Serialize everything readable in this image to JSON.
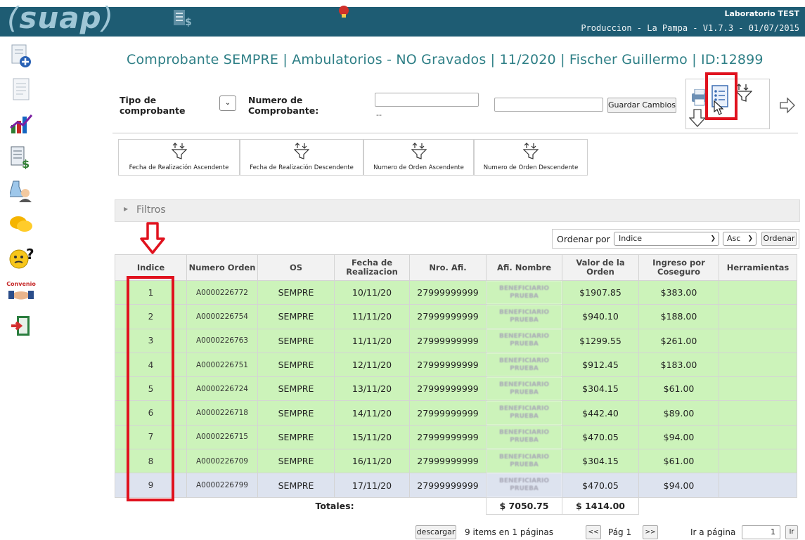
{
  "header": {
    "logo": "suap",
    "lab": "Laboratorio TEST",
    "prod": "Produccion - La Pampa - V1.7.3 - 01/07/2015"
  },
  "sidebar": {
    "items": [
      {
        "icon": "new-document-icon"
      },
      {
        "icon": "document-icon"
      },
      {
        "icon": "chart-icon"
      },
      {
        "icon": "billing-document-icon"
      },
      {
        "icon": "lab-user-icon"
      },
      {
        "icon": "chat-icon"
      },
      {
        "icon": "help-icon"
      },
      {
        "icon": "convenio-icon",
        "label": "Convenio"
      },
      {
        "icon": "exit-icon"
      }
    ]
  },
  "page": {
    "title": "Comprobante SEMPRE | Ambulatorios - NO Gravados | 11/2020 | Fischer Guillermo | ID:12899"
  },
  "form": {
    "tipo_label": "Tipo de comprobante",
    "numero_label": "Numero de Comprobante:",
    "dashes": "--",
    "guardar_label": "Guardar Cambios"
  },
  "sort_buttons": [
    "Fecha de Realización Ascendente",
    "Fecha de Realización Descendente",
    "Numero de Orden Ascendente",
    "Numero de Orden Descendente"
  ],
  "filters": {
    "label": "Filtros"
  },
  "order": {
    "label": "Ordenar por",
    "selected": "Indice",
    "direction": "Asc",
    "button": "Ordenar"
  },
  "table": {
    "headers": [
      "Indice",
      "Numero Orden",
      "OS",
      "Fecha de Realizacion",
      "Nro. Afi.",
      "Afi. Nombre",
      "Valor de la Orden",
      "Ingreso por Coseguro",
      "Herramientas"
    ],
    "rows": [
      {
        "indice": "1",
        "orden": "A0000226772",
        "os": "SEMPRE",
        "fecha": "10/11/20",
        "afi": "27999999999",
        "nombre": "BENEFICIARIO PRUEBA",
        "valor": "$1907.85",
        "coseguro": "$383.00",
        "herr": ""
      },
      {
        "indice": "2",
        "orden": "A0000226754",
        "os": "SEMPRE",
        "fecha": "11/11/20",
        "afi": "27999999999",
        "nombre": "BENEFICIARIO PRUEBA",
        "valor": "$940.10",
        "coseguro": "$188.00",
        "herr": ""
      },
      {
        "indice": "3",
        "orden": "A0000226763",
        "os": "SEMPRE",
        "fecha": "11/11/20",
        "afi": "27999999999",
        "nombre": "BENEFICIARIO PRUEBA",
        "valor": "$1299.55",
        "coseguro": "$261.00",
        "herr": ""
      },
      {
        "indice": "4",
        "orden": "A0000226751",
        "os": "SEMPRE",
        "fecha": "12/11/20",
        "afi": "27999999999",
        "nombre": "BENEFICIARIO PRUEBA",
        "valor": "$912.45",
        "coseguro": "$183.00",
        "herr": ""
      },
      {
        "indice": "5",
        "orden": "A0000226724",
        "os": "SEMPRE",
        "fecha": "13/11/20",
        "afi": "27999999999",
        "nombre": "BENEFICIARIO PRUEBA",
        "valor": "$304.15",
        "coseguro": "$61.00",
        "herr": ""
      },
      {
        "indice": "6",
        "orden": "A0000226718",
        "os": "SEMPRE",
        "fecha": "14/11/20",
        "afi": "27999999999",
        "nombre": "BENEFICIARIO PRUEBA",
        "valor": "$442.40",
        "coseguro": "$89.00",
        "herr": ""
      },
      {
        "indice": "7",
        "orden": "A0000226715",
        "os": "SEMPRE",
        "fecha": "15/11/20",
        "afi": "27999999999",
        "nombre": "BENEFICIARIO PRUEBA",
        "valor": "$470.05",
        "coseguro": "$94.00",
        "herr": ""
      },
      {
        "indice": "8",
        "orden": "A0000226709",
        "os": "SEMPRE",
        "fecha": "16/11/20",
        "afi": "27999999999",
        "nombre": "BENEFICIARIO PRUEBA",
        "valor": "$304.15",
        "coseguro": "$61.00",
        "herr": ""
      },
      {
        "indice": "9",
        "orden": "A0000226799",
        "os": "SEMPRE",
        "fecha": "17/11/20",
        "afi": "27999999999",
        "nombre": "BENEFICIARIO PRUEBA",
        "valor": "$470.05",
        "coseguro": "$94.00",
        "herr": ""
      }
    ],
    "totals_label": "Totales:",
    "total_valor": "$ 7050.75",
    "total_coseguro": "$ 1414.00"
  },
  "footer": {
    "descargar": "descargar",
    "items_info": "9 items en 1 páginas",
    "prev": "<<",
    "page": "Pág 1",
    "next": ">>",
    "ir_label": "Ir a página",
    "ir_value": "1",
    "ir_btn": "Ir"
  },
  "colors": {
    "header_bg": "#1e5c73",
    "row_green": "#ccf3ba",
    "row_selected": "#dde3ef",
    "title_teal": "#2e7f86",
    "highlight_red": "#e0121e"
  }
}
